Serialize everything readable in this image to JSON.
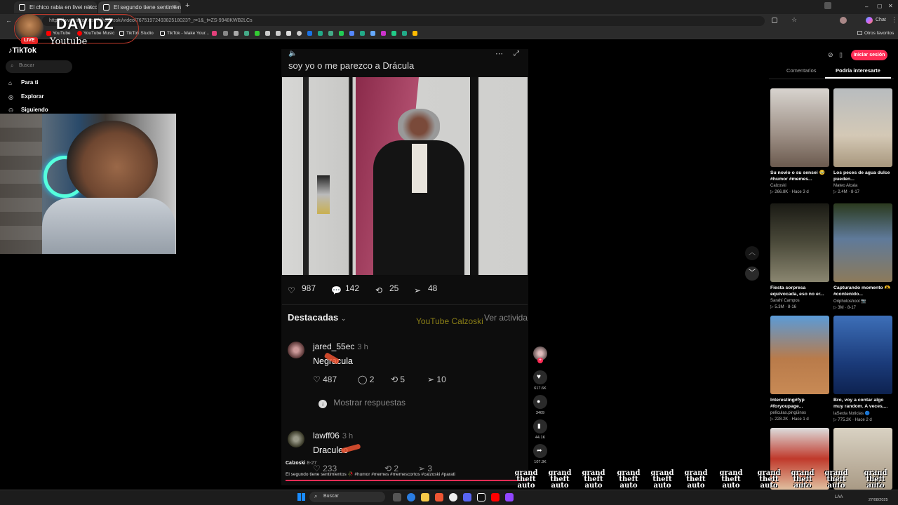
{
  "browser": {
    "tabs": [
      {
        "title": "El chico rabia en livei reacciones y"
      },
      {
        "title": "El segundo tiene sentimientos"
      }
    ],
    "url": "https://www.tiktok.com/@calzoski/video/7675197249382518023?_r=1&_t=ZS-9948KWB2LCs",
    "bookmarks": [
      "YouTube",
      "YouTube Music",
      "TikTok Studio",
      "TikTok - Make Your..."
    ],
    "other_bookmarks": "Otros favoritos",
    "chat_label": "Chat"
  },
  "streamer": {
    "name": "DAVIDZ",
    "platform": "Youtube",
    "live_badge": "LIVE"
  },
  "tiktok": {
    "logo": "TikTok",
    "search_placeholder": "Buscar",
    "nav": [
      "Para ti",
      "Explorar",
      "Siguiendo"
    ],
    "login_button": "Iniciar sesión",
    "right_tabs": [
      "Comentarios",
      "Podría interesarte"
    ]
  },
  "video": {
    "caption": "soy yo o me parezco a Drácula",
    "likes": "987",
    "comments": "142",
    "reposts": "25",
    "shares": "48",
    "author": "Calzoski",
    "date": "8-27",
    "description": "El segundo tiene sentimientos 🥀 #humor #memes #memescortos #calzoski #parati",
    "overlay_watermark": "YouTube Calzoski"
  },
  "comments_section": {
    "sort_label": "Destacadas",
    "see_activity": "Ver actividad",
    "comments": [
      {
        "user": "jared_55ec",
        "time": "3 h",
        "text": "Negracula",
        "likes": "487",
        "replies": "2",
        "reposts": "5",
        "shares": "10",
        "show_replies": "Mostrar respuestas"
      },
      {
        "user": "lawff06",
        "time": "3 h",
        "text": "Draculeo",
        "likes": "233",
        "replies": "",
        "reposts": "2",
        "shares": "3"
      }
    ]
  },
  "actions": {
    "likes": "617.6K",
    "comments": "3409",
    "saves": "44.1K",
    "shares": "107.3K"
  },
  "suggested": [
    {
      "title": "Su novio o su sensei 🥹 #humor #memes...",
      "author": "Calzoski",
      "views": "266.8K",
      "date": "Hace 3 d"
    },
    {
      "title": "Los peces de agua dulce pueden...",
      "author": "Mateo Alcala",
      "views": "2.4M",
      "date": "8-17"
    },
    {
      "title": "Fiesta sorpresa equivocada, eso no er...",
      "author": "Sarahí Campos",
      "views": "5.3M",
      "date": "8-16"
    },
    {
      "title": "Capturando momento 🫶 #contenido...",
      "author": "Oriphotoshoot 📷",
      "views": "3M",
      "date": "8-17"
    },
    {
      "title": "Interesting#fyp #foryoupage...",
      "author": "pelìculas.pingüinos",
      "views": "228.2K",
      "date": "Hace 1 d"
    },
    {
      "title": "Bro, voy a contar algo muy random. A veces,...",
      "author": "laSexta Noticias 🔵",
      "views": "775.2K",
      "date": "Hace 2 d"
    }
  ],
  "taskbar": {
    "search": "Buscar",
    "time": "27/08/2025",
    "lang": "LAA"
  },
  "gta_logo_text": [
    "grand",
    "theft",
    "auto"
  ]
}
